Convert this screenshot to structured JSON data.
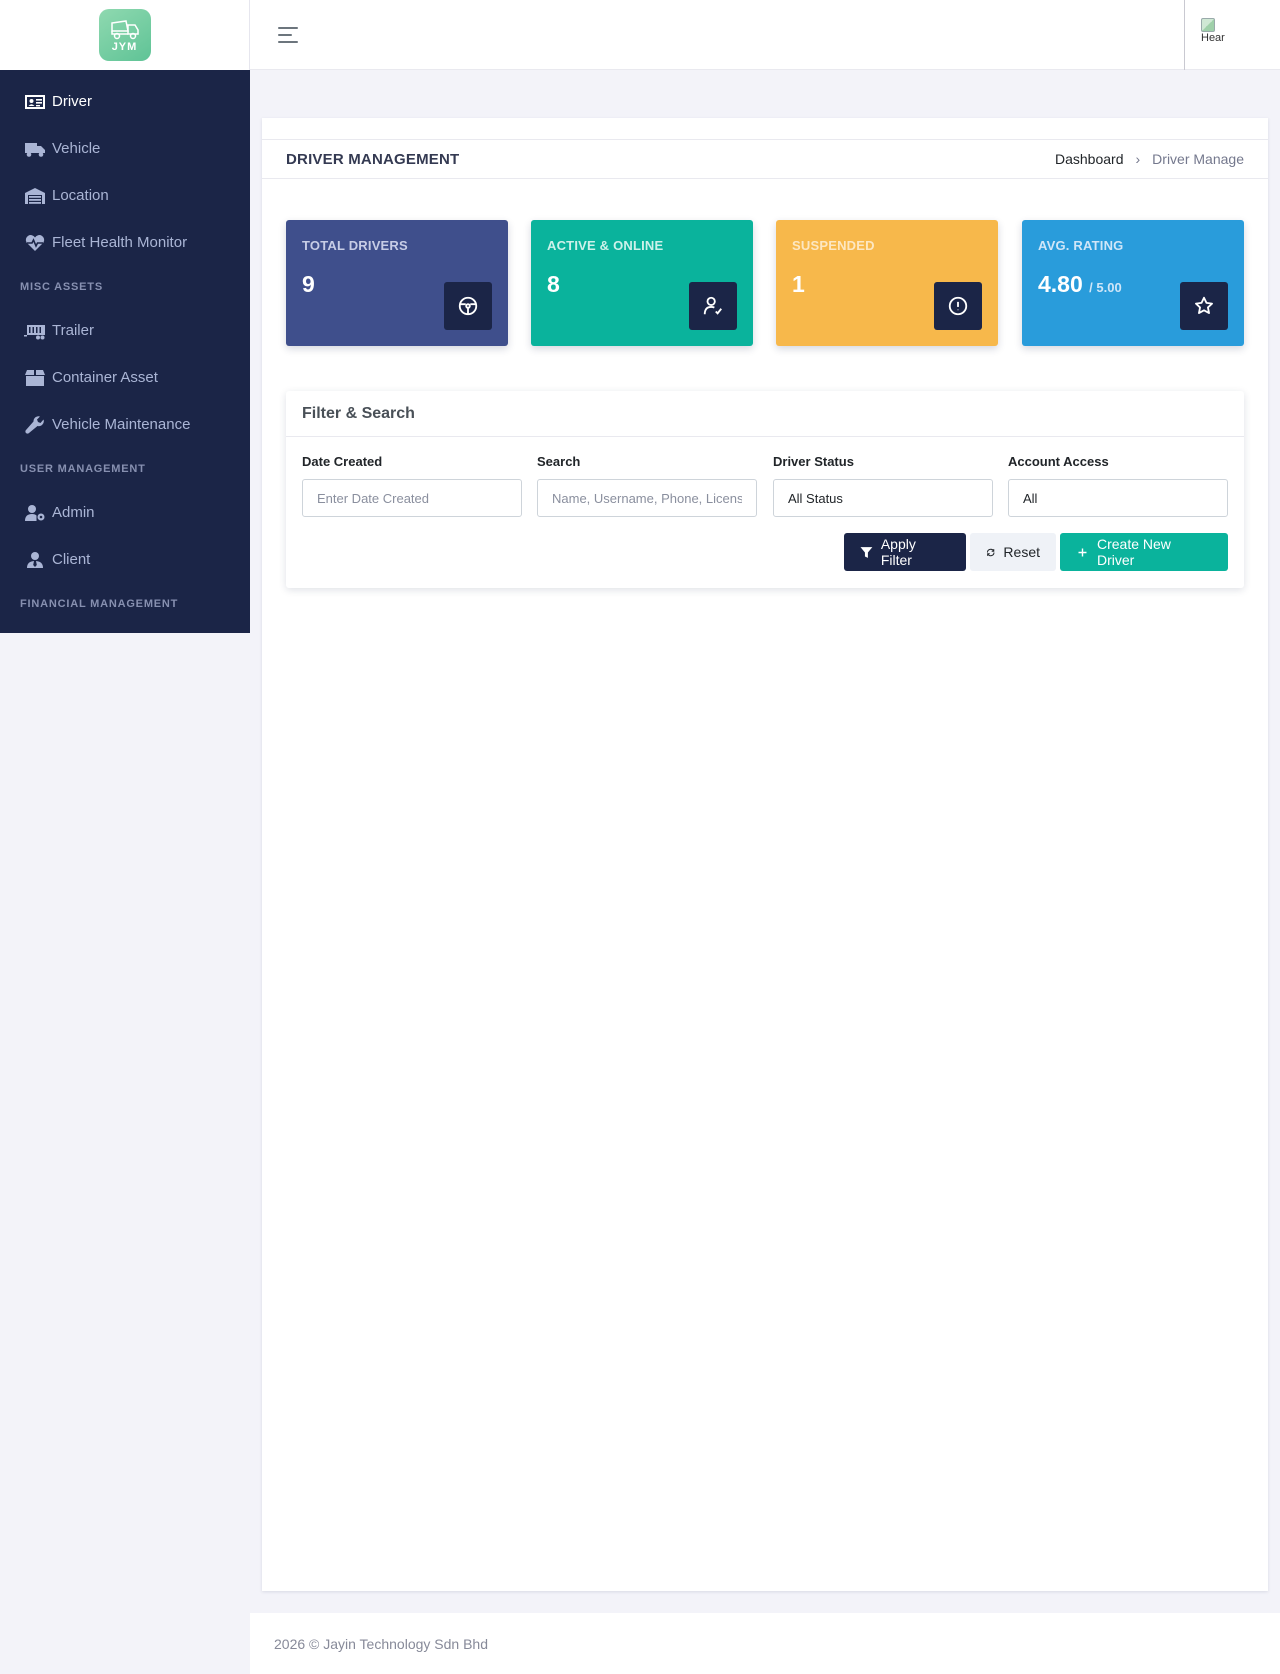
{
  "brand": {
    "logo_text": "JYM"
  },
  "sidebar": {
    "items": [
      {
        "label": "Driver",
        "icon": "id-card-icon",
        "active": true
      },
      {
        "label": "Vehicle",
        "icon": "truck-icon"
      },
      {
        "label": "Location",
        "icon": "warehouse-icon"
      },
      {
        "label": "Fleet Health Monitor",
        "icon": "heart-pulse-icon"
      }
    ],
    "sections": [
      {
        "title": "MISC ASSETS",
        "items": [
          {
            "label": "Trailer",
            "icon": "trailer-icon"
          },
          {
            "label": "Container Asset",
            "icon": "box-icon"
          },
          {
            "label": "Vehicle Maintenance",
            "icon": "wrench-icon"
          }
        ]
      },
      {
        "title": "USER MANAGEMENT",
        "items": [
          {
            "label": "Admin",
            "icon": "user-gear-icon"
          },
          {
            "label": "Client",
            "icon": "user-tie-icon"
          }
        ]
      },
      {
        "title": "FINANCIAL MANAGEMENT",
        "items": []
      }
    ]
  },
  "topbar": {
    "avatar_alt": "Hear"
  },
  "page": {
    "title": "DRIVER MANAGEMENT",
    "breadcrumb": {
      "home": "Dashboard",
      "current": "Driver Manage"
    }
  },
  "stats": [
    {
      "label": "TOTAL DRIVERS",
      "value": "9",
      "icon": "steering-wheel-icon",
      "bg": "#3f4f8c",
      "label_color": "#c7cde6"
    },
    {
      "label": "ACTIVE & ONLINE",
      "value": "8",
      "icon": "user-check-icon",
      "bg": "#0ab39c",
      "label_color": "#cdf1ea"
    },
    {
      "label": "SUSPENDED",
      "value": "1",
      "icon": "alert-circle-icon",
      "bg": "#f7b84b",
      "label_color": "#fde7c2"
    },
    {
      "label": "AVG. RATING",
      "value": "4.80",
      "suffix": "/ 5.00",
      "icon": "star-icon",
      "bg": "#299cdb",
      "label_color": "#cfe6f8"
    }
  ],
  "filter": {
    "title": "Filter & Search",
    "fields": {
      "date_created": {
        "label": "Date Created",
        "placeholder": "Enter Date Created"
      },
      "search": {
        "label": "Search",
        "placeholder": "Name, Username, Phone, License"
      },
      "driver_status": {
        "label": "Driver Status",
        "value": "All Status"
      },
      "account_access": {
        "label": "Account Access",
        "value": "All"
      }
    },
    "buttons": {
      "apply": "Apply Filter",
      "reset": "Reset",
      "create": "Create New Driver"
    }
  },
  "footer": {
    "text": "2026 © Jayin Technology Sdn Bhd"
  }
}
